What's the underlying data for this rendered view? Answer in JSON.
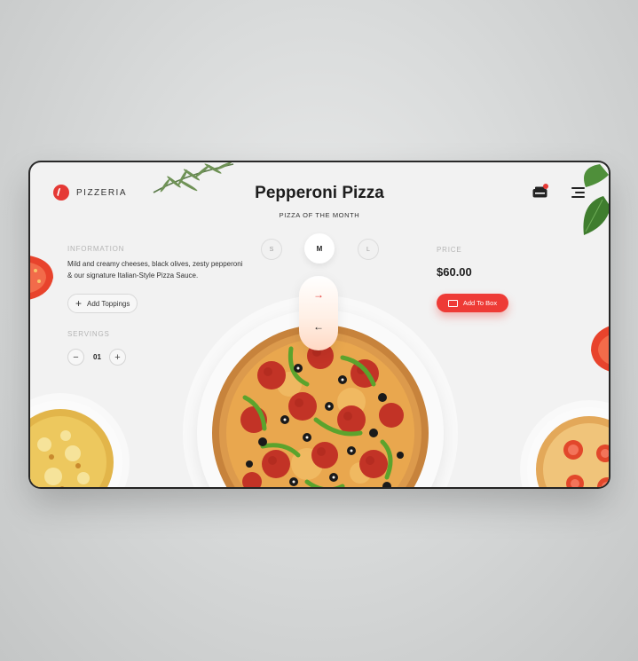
{
  "brand": {
    "name": "PIZZERIA"
  },
  "product": {
    "title": "Pepperoni Pizza",
    "subtitle": "PIZZA OF THE MONTH"
  },
  "info": {
    "label": "INFORMATION",
    "description": "Mild and creamy cheeses, black olives, zesty pepperoni & our signature Italian-Style Pizza Sauce.",
    "add_toppings_label": "Add Toppings"
  },
  "servings": {
    "label": "SERVINGS",
    "quantity": "01",
    "minus": "−",
    "plus": "+"
  },
  "sizes": {
    "options": [
      "S",
      "M",
      "L"
    ],
    "selected": "M"
  },
  "price": {
    "label": "PRICE",
    "value": "$60.00",
    "add_to_box_label": "Add To Box"
  },
  "nav": {
    "next": "→",
    "prev": "←"
  },
  "colors": {
    "accent": "#ee3b36",
    "background": "#f2f2f2",
    "text": "#1d1d1d"
  },
  "icons": {
    "logo": "pizzeria-logo-icon",
    "cart": "cart-icon",
    "menu": "menu-icon",
    "plus": "plus-icon",
    "box": "box-icon"
  }
}
